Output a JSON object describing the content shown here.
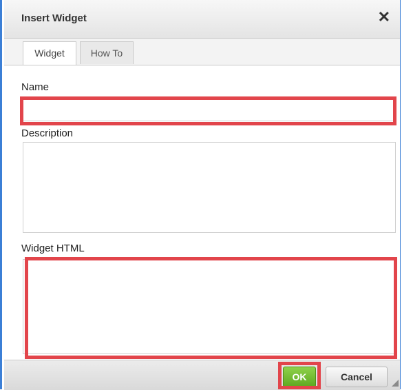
{
  "dialog": {
    "title": "Insert Widget",
    "close_icon": "close-icon",
    "close_glyph": "✕"
  },
  "tabs": [
    {
      "label": "Widget",
      "active": true
    },
    {
      "label": "How To",
      "active": false
    }
  ],
  "form": {
    "name_label": "Name",
    "name_value": "",
    "description_label": "Description",
    "description_value": "",
    "widget_html_label": "Widget HTML",
    "widget_html_value": ""
  },
  "footer": {
    "ok_label": "OK",
    "cancel_label": "Cancel"
  },
  "colors": {
    "accent_border": "#3b7fd6",
    "highlight": "#e2454b",
    "ok_button": "#6cb52a"
  }
}
